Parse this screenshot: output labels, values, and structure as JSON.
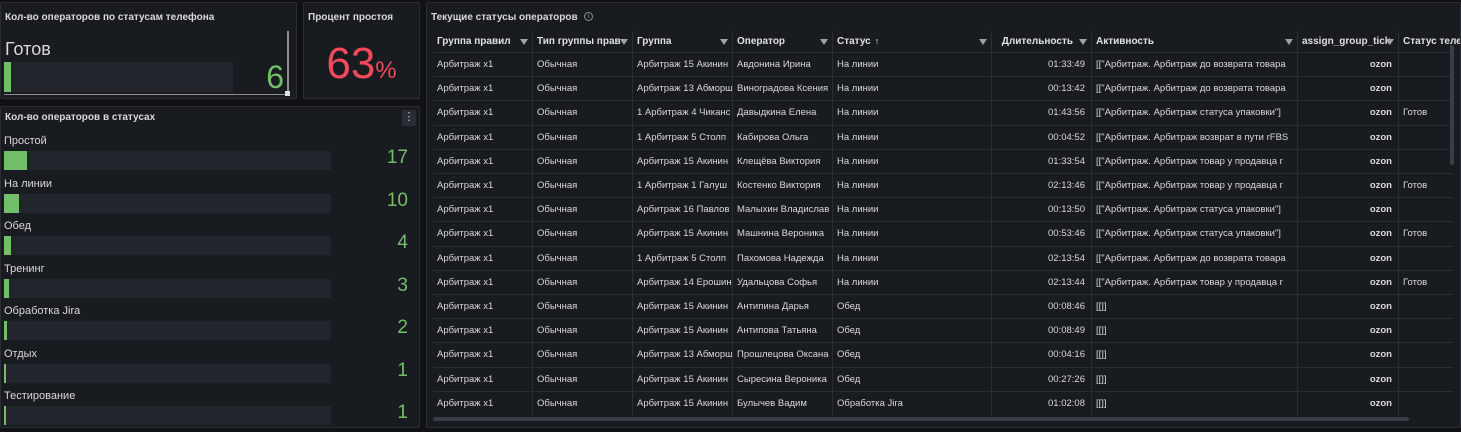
{
  "phone_panel": {
    "title": "Кол-во операторов по статусам телефона",
    "label": "Готов",
    "value": "6",
    "bar_fill": 0.03
  },
  "idle_panel": {
    "title": "Процент простоя",
    "value": "63",
    "unit": "%"
  },
  "status_panel": {
    "title": "Кол-во операторов в статусах",
    "menu_icon": "kebab-menu-icon",
    "items": [
      {
        "label": "Простой",
        "value": "17",
        "fill": 0.07
      },
      {
        "label": "На линии",
        "value": "10",
        "fill": 0.045
      },
      {
        "label": "Обед",
        "value": "4",
        "fill": 0.02
      },
      {
        "label": "Тренинг",
        "value": "3",
        "fill": 0.015
      },
      {
        "label": "Обработка Jira",
        "value": "2",
        "fill": 0.01
      },
      {
        "label": "Отдых",
        "value": "1",
        "fill": 0.005
      },
      {
        "label": "Тестирование",
        "value": "1",
        "fill": 0.005
      }
    ]
  },
  "table_panel": {
    "title": "Текущие статусы операторов",
    "info_icon": "info-icon",
    "filter_icon": "filter-icon",
    "sort_icon": "sort-asc-icon",
    "columns": [
      "Группа правил",
      "Тип группы прав",
      "Группа",
      "Оператор",
      "Статус",
      "Длительность",
      "Активность",
      "assign_group_tick",
      "Статус теле"
    ],
    "status_sort_arrow": "↑",
    "rows": [
      [
        "Арбитраж x1",
        "Обычная",
        "Арбитраж 15 Акинин",
        "Авдонина Ирина",
        "На линии",
        "01:33:49",
        "[[\"Арбитраж. Арбитраж до возврата товара",
        "ozon",
        ""
      ],
      [
        "Арбитраж x1",
        "Обычная",
        "Арбитраж 13 Абморш",
        "Виноградова Ксения",
        "На линии",
        "00:13:42",
        "[[\"Арбитраж. Арбитраж до возврата товара",
        "ozon",
        ""
      ],
      [
        "Арбитраж x1",
        "Обычная",
        "1 Арбитраж 4 Чиканс",
        "Давыдкина Елена",
        "На линии",
        "01:43:56",
        "[[\"Арбитраж. Арбитраж статуса упаковки\"]",
        "ozon",
        "Готов"
      ],
      [
        "Арбитраж x1",
        "Обычная",
        "1 Арбитраж 5 Столп",
        "Кабирова Ольга",
        "На линии",
        "00:04:52",
        "[[\"Арбитраж. Арбитраж возврат в пути rFBS",
        "ozon",
        ""
      ],
      [
        "Арбитраж x1",
        "Обычная",
        "Арбитраж 15 Акинин",
        "Клещёва Виктория",
        "На линии",
        "01:33:54",
        "[[\"Арбитраж. Арбитраж товар у продавца r",
        "ozon",
        ""
      ],
      [
        "Арбитраж x1",
        "Обычная",
        "1 Арбитраж 1 Галуш",
        "Костенко Виктория",
        "На линии",
        "02:13:46",
        "[[\"Арбитраж. Арбитраж товар у продавца r",
        "ozon",
        "Готов"
      ],
      [
        "Арбитраж x1",
        "Обычная",
        "Арбитраж 16 Павлов",
        "Малыхин Владислав",
        "На линии",
        "00:13:50",
        "[[\"Арбитраж. Арбитраж статуса упаковки\"]",
        "ozon",
        ""
      ],
      [
        "Арбитраж x1",
        "Обычная",
        "Арбитраж 15 Акинин",
        "Машнина Вероника",
        "На линии",
        "00:53:46",
        "[[\"Арбитраж. Арбитраж статуса упаковки\"]",
        "ozon",
        "Готов"
      ],
      [
        "Арбитраж x1",
        "Обычная",
        "1 Арбитраж 5 Столп",
        "Пахомова Надежда",
        "На линии",
        "02:13:54",
        "[[\"Арбитраж. Арбитраж до возврата товара",
        "ozon",
        ""
      ],
      [
        "Арбитраж x1",
        "Обычная",
        "Арбитраж 14 Ерошин",
        "Удальцова Софья",
        "На линии",
        "02:13:44",
        "[[\"Арбитраж. Арбитраж товар у продавца r",
        "ozon",
        "Готов"
      ],
      [
        "Арбитраж x1",
        "Обычная",
        "Арбитраж 15 Акинин",
        "Антипина Дарья",
        "Обед",
        "00:08:46",
        "[[]]",
        "ozon",
        ""
      ],
      [
        "Арбитраж x1",
        "Обычная",
        "Арбитраж 15 Акинин",
        "Антипова Татьяна",
        "Обед",
        "00:08:49",
        "[[]]",
        "ozon",
        ""
      ],
      [
        "Арбитраж x1",
        "Обычная",
        "Арбитраж 13 Абморш",
        "Прошлецова Оксана",
        "Обед",
        "00:04:16",
        "[[]]",
        "ozon",
        ""
      ],
      [
        "Арбитраж x1",
        "Обычная",
        "Арбитраж 15 Акинин",
        "Сыресина Вероника",
        "Обед",
        "00:27:26",
        "[[]]",
        "ozon",
        ""
      ],
      [
        "Арбитраж x1",
        "Обычная",
        "Арбитраж 15 Акинин",
        "Булычев Вадим",
        "Обработка Jira",
        "01:02:08",
        "[[]]",
        "ozon",
        ""
      ]
    ]
  },
  "colors": {
    "background": "#111217",
    "panel": "#181b1f",
    "green": "#73bf69",
    "red": "#f2495c"
  }
}
